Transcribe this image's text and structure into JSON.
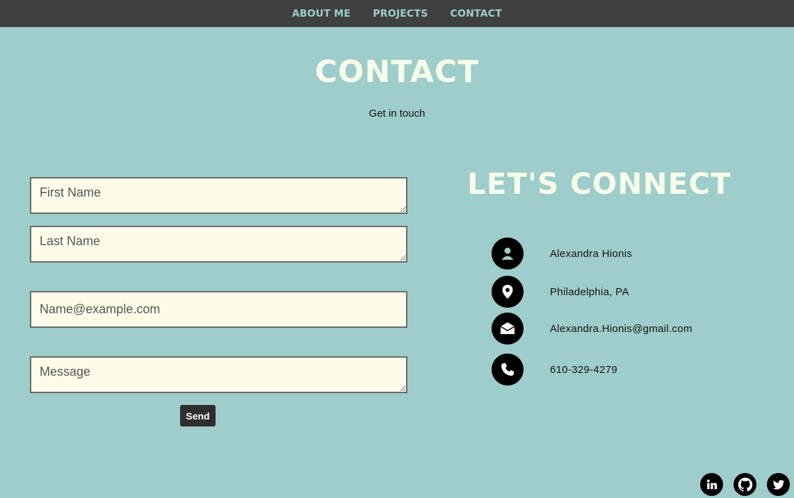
{
  "nav": {
    "items": [
      {
        "label": "ABOUT ME"
      },
      {
        "label": "PROJECTS"
      },
      {
        "label": "CONTACT"
      }
    ]
  },
  "header": {
    "title": "CONTACT",
    "subtitle": "Get in touch"
  },
  "form": {
    "first_name_placeholder": "First Name",
    "last_name_placeholder": "Last Name",
    "email_placeholder": "Name@example.com",
    "message_placeholder": "Message",
    "send_label": "Send"
  },
  "connect": {
    "title": "LET'S CONNECT",
    "items": [
      {
        "icon": "person-icon",
        "text": "Alexandra Hionis"
      },
      {
        "icon": "location-pin-icon",
        "text": "Philadelphia, PA"
      },
      {
        "icon": "envelope-icon",
        "text": "Alexandra.Hionis@gmail.com"
      },
      {
        "icon": "phone-icon",
        "text": "610-329-4279"
      }
    ]
  },
  "social": [
    {
      "icon": "linkedin-icon"
    },
    {
      "icon": "github-icon"
    },
    {
      "icon": "twitter-icon"
    }
  ],
  "colors": {
    "background": "#9ecdcb",
    "nav_bg": "#404040",
    "heading": "#f6fde8",
    "field_bg": "#fffdea",
    "button_bg": "#2e2e2e"
  }
}
